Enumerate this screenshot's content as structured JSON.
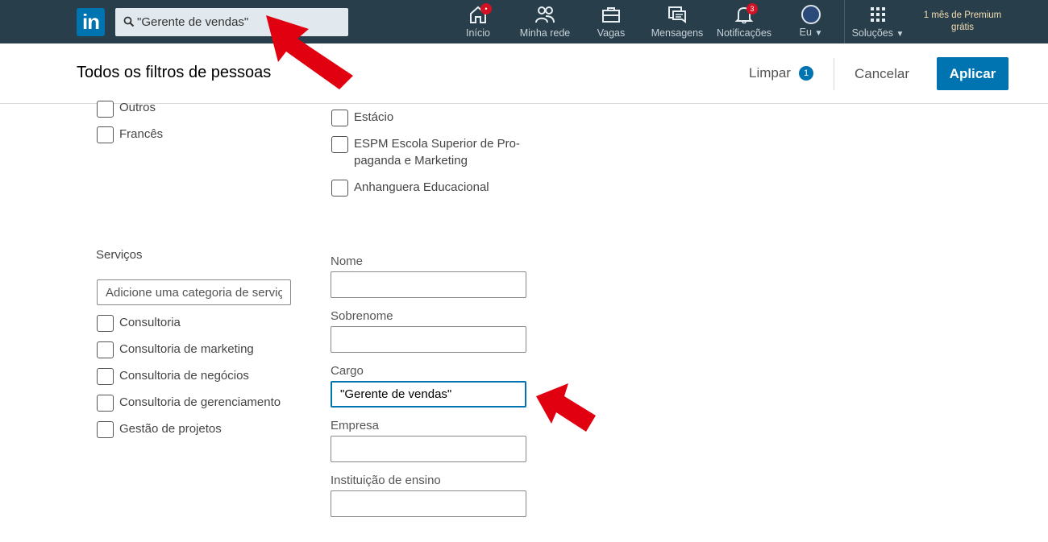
{
  "nav": {
    "logo_text": "in",
    "search_value": "\"Gerente de vendas\"",
    "items": [
      {
        "label": "Início",
        "badge": "•"
      },
      {
        "label": "Minha rede"
      },
      {
        "label": "Vagas"
      },
      {
        "label": "Mensagens"
      },
      {
        "label": "Notificações",
        "badge": "3"
      },
      {
        "label": "Eu"
      },
      {
        "label": "Soluções"
      }
    ],
    "premium": {
      "line1": "1 mês de Premium",
      "line2": "grátis"
    }
  },
  "header": {
    "title": "Todos os filtros de pessoas",
    "clear_label": "Limpar",
    "clear_count": "1",
    "cancel_label": "Cancelar",
    "apply_label": "Aplicar"
  },
  "languages": {
    "options": [
      "Outros",
      "Francês"
    ]
  },
  "schools": {
    "options": [
      "Estácio",
      "ESPM Escola Superior de Pro-",
      "paganda e Marketing",
      "Anhanguera Educacional"
    ]
  },
  "services": {
    "label": "Serviços",
    "placeholder": "Adicione uma categoria de serviço",
    "options": [
      "Consultoria",
      "Consultoria de marketing",
      "Consultoria de negócios",
      "Consultoria de gerenciamento",
      "Gestão de projetos"
    ]
  },
  "keywords": {
    "fields": [
      {
        "label": "Nome",
        "value": ""
      },
      {
        "label": "Sobrenome",
        "value": ""
      },
      {
        "label": "Cargo",
        "value": "\"Gerente de vendas\""
      },
      {
        "label": "Empresa",
        "value": ""
      },
      {
        "label": "Instituição de ensino",
        "value": ""
      }
    ]
  },
  "colors": {
    "nav_bg": "#283e4a",
    "brand_blue": "#0073b1",
    "arrow_red": "#e0000f",
    "badge_red": "#d11124"
  }
}
